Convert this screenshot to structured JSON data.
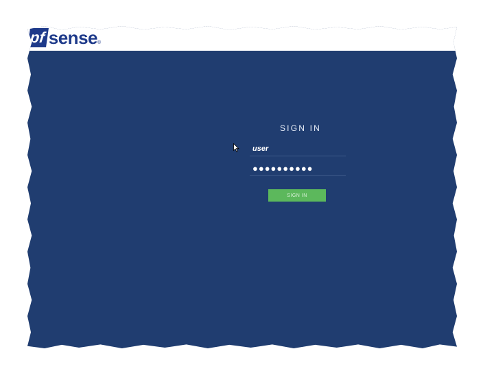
{
  "brand": {
    "prefix": "pf",
    "name": "sense",
    "mark": "®"
  },
  "login": {
    "title": "SIGN IN",
    "username_value": "user",
    "password_value": "●●●●●●●●●●",
    "button_label": "SIGN IN"
  },
  "colors": {
    "background": "#203d70",
    "header": "#ffffff",
    "brand_blue": "#1e3a8a",
    "button": "#5cb85c"
  },
  "icons": {
    "cursor": "mouse-pointer-icon"
  }
}
